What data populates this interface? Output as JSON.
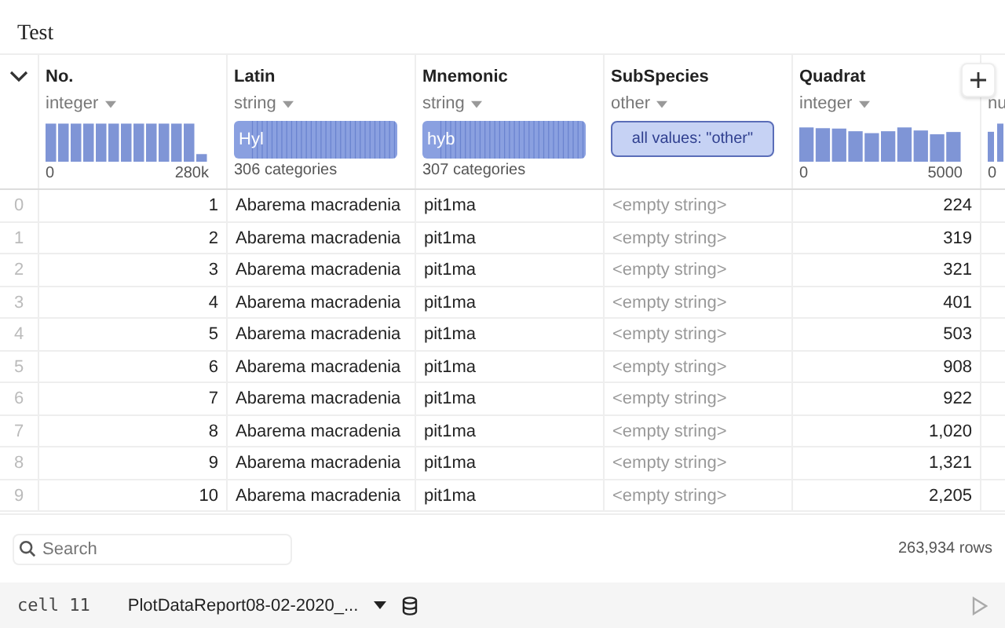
{
  "title": "Test",
  "columns": [
    {
      "kind": "hist",
      "name": "No.",
      "type": "integer",
      "min": "0",
      "max": "280k"
    },
    {
      "kind": "cat",
      "name": "Latin",
      "type": "string",
      "sample": "Hyl",
      "caption": "306 categories"
    },
    {
      "kind": "cat",
      "name": "Mnemonic",
      "type": "string",
      "sample": "hyb",
      "caption": "307 categories"
    },
    {
      "kind": "single",
      "name": "SubSpecies",
      "type": "other",
      "sample": "all values: \"other\""
    },
    {
      "kind": "hist",
      "name": "Quadrat",
      "type": "integer",
      "min": "0",
      "max": "5000"
    },
    {
      "kind": "cut",
      "type": "nu",
      "min": "0"
    }
  ],
  "rows": [
    {
      "index": "0",
      "cells": [
        "1",
        "Abarema macradenia",
        "pit1ma",
        "<empty string>",
        "224"
      ]
    },
    {
      "index": "1",
      "cells": [
        "2",
        "Abarema macradenia",
        "pit1ma",
        "<empty string>",
        "319"
      ]
    },
    {
      "index": "2",
      "cells": [
        "3",
        "Abarema macradenia",
        "pit1ma",
        "<empty string>",
        "321"
      ]
    },
    {
      "index": "3",
      "cells": [
        "4",
        "Abarema macradenia",
        "pit1ma",
        "<empty string>",
        "401"
      ]
    },
    {
      "index": "4",
      "cells": [
        "5",
        "Abarema macradenia",
        "pit1ma",
        "<empty string>",
        "503"
      ]
    },
    {
      "index": "5",
      "cells": [
        "6",
        "Abarema macradenia",
        "pit1ma",
        "<empty string>",
        "908"
      ]
    },
    {
      "index": "6",
      "cells": [
        "7",
        "Abarema macradenia",
        "pit1ma",
        "<empty string>",
        "922"
      ]
    },
    {
      "index": "7",
      "cells": [
        "8",
        "Abarema macradenia",
        "pit1ma",
        "<empty string>",
        "1,020"
      ]
    },
    {
      "index": "8",
      "cells": [
        "9",
        "Abarema macradenia",
        "pit1ma",
        "<empty string>",
        "1,321"
      ]
    },
    {
      "index": "9",
      "cells": [
        "10",
        "Abarema macradenia",
        "pit1ma",
        "<empty string>",
        "2,205"
      ]
    }
  ],
  "search": {
    "placeholder": "Search"
  },
  "row_count": "263,934 rows",
  "footer": {
    "cell": "cell 11",
    "file": "PlotDataReport08-02-2020_..."
  }
}
